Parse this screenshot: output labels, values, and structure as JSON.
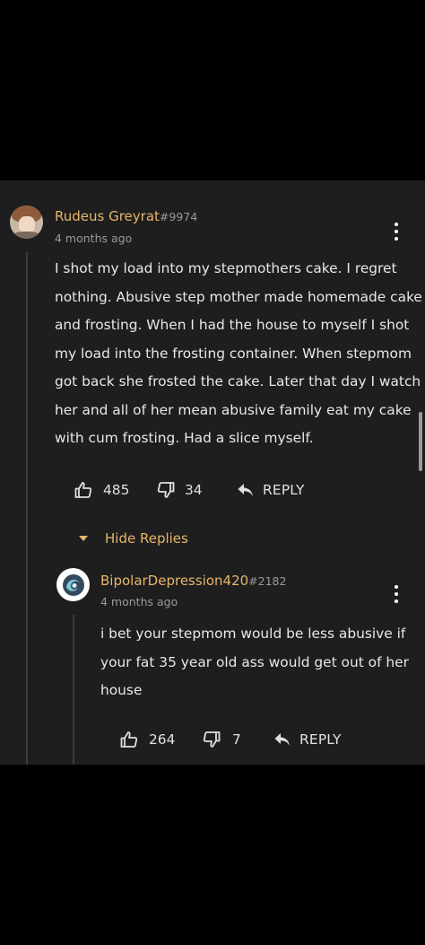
{
  "comment": {
    "username": "Rudeus Greyrat",
    "user_tag": "#9974",
    "timestamp": "4 months ago",
    "lines": [
      "I shot my load into my stepmothers cake. I regret",
      "nothing. Abusive step mother made homemade cake",
      "and frosting. When I had the house to myself I shot",
      "my load into the frosting container. When stepmom",
      "got back she frosted the cake. Later that day I watch",
      "her and all of her mean abusive family eat my cake",
      "with cum frosting. Had a slice myself."
    ],
    "likes": "485",
    "dislikes": "34",
    "reply_label": "REPLY",
    "hide_replies_label": "Hide Replies"
  },
  "reply": {
    "username": "BipolarDepression420",
    "user_tag": "#2182",
    "timestamp": "4 months ago",
    "lines": [
      "i bet your stepmom would be less abusive if",
      "your fat 35 year old ass would get out of her",
      "house"
    ],
    "likes": "264",
    "dislikes": "7",
    "reply_label": "REPLY"
  },
  "colors": {
    "username": "#e8b56a",
    "panel_background": "#1e1e1e",
    "page_background": "#000000",
    "secondary_text": "#9a9a9a"
  },
  "icons": [
    "user-avatar",
    "more-options-icon",
    "thumbs-up-icon",
    "thumbs-down-icon",
    "reply-arrow-icon",
    "caret-down-icon",
    "vortex-avatar"
  ]
}
